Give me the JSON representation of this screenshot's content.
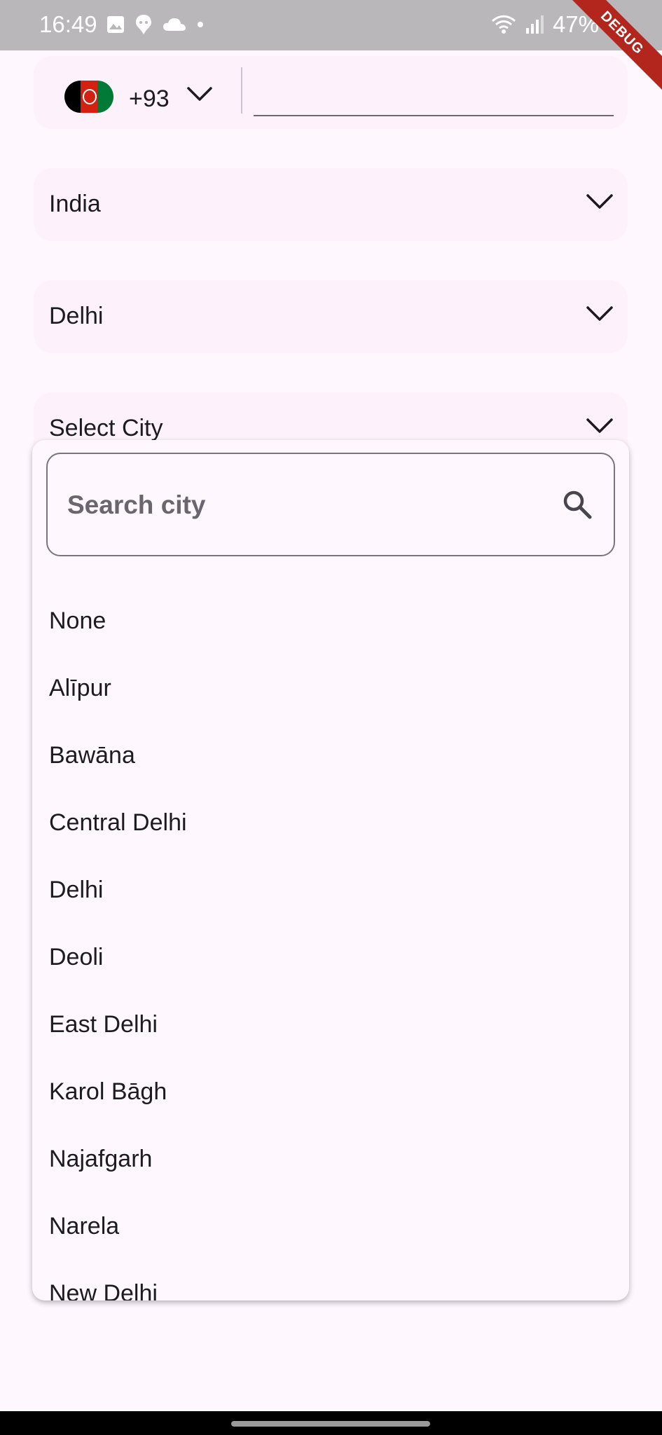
{
  "status_bar": {
    "time": "16:49",
    "battery": "47%",
    "ribbon": "DEBUG"
  },
  "phone": {
    "dial_code": "+93",
    "flag_colors": [
      "#000000",
      "#d32011",
      "#007a36"
    ],
    "number_value": ""
  },
  "country_dropdown": {
    "selected": "India"
  },
  "state_dropdown": {
    "selected": "Delhi"
  },
  "city_dropdown": {
    "selected": "Select City"
  },
  "city_popup": {
    "search_placeholder": "Search city",
    "items": [
      "None",
      "Alīpur",
      "Bawāna",
      "Central Delhi",
      "Delhi",
      "Deoli",
      "East Delhi",
      "Karol Bāgh",
      "Najafgarh",
      "Narela",
      "New Delhi"
    ]
  },
  "icons": {
    "chevron": "chevron-down-icon",
    "search": "search-icon"
  }
}
